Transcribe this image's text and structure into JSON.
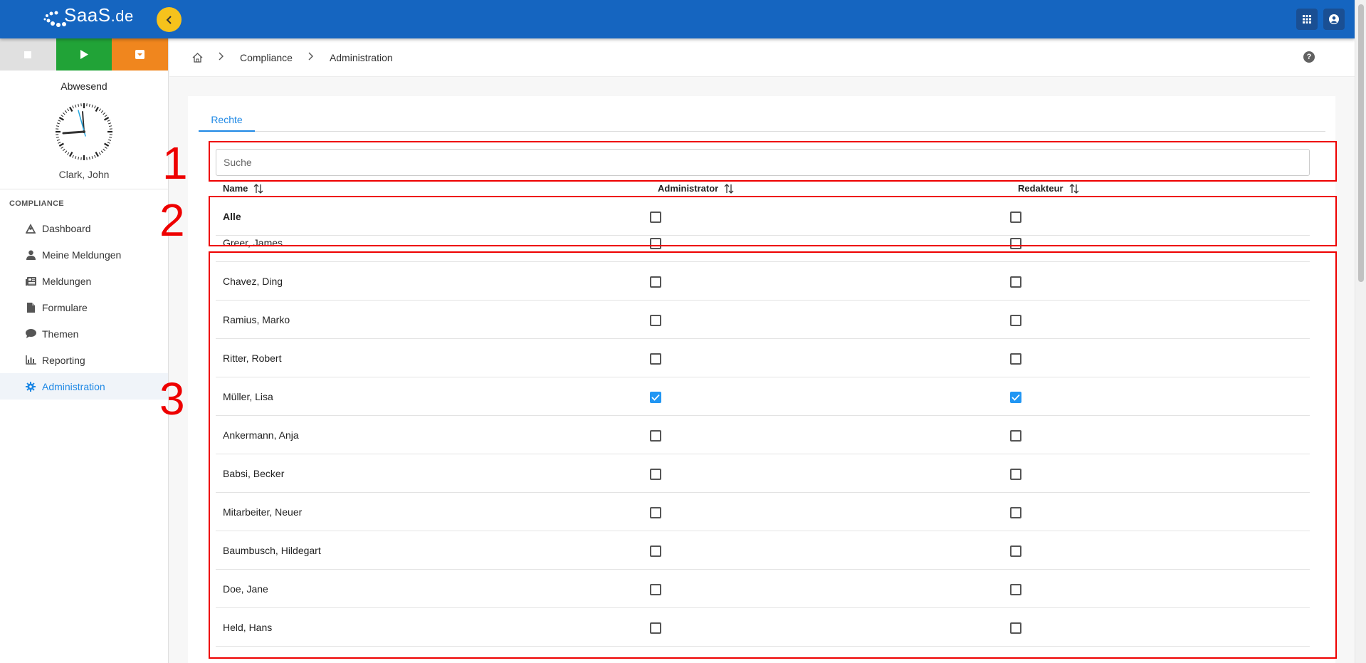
{
  "topbar": {
    "logo_text": "SaaS",
    "logo_suffix": ".de",
    "brand_color": "#1565c0",
    "collapse_icon": "chevron-left-icon",
    "apps_icon": "apps-grid-icon",
    "account_icon": "account-circle-icon"
  },
  "sidebar": {
    "status_buttons": [
      {
        "icon": "stop-icon",
        "color": "#e0e0e0"
      },
      {
        "icon": "play-icon",
        "color": "#21a337"
      },
      {
        "icon": "dropdown-icon",
        "color": "#f0861e"
      }
    ],
    "status_label": "Abwesend",
    "user_name": "Clark, John",
    "section_title": "COMPLIANCE",
    "items": [
      {
        "label": "Dashboard",
        "icon": "dashboard-icon"
      },
      {
        "label": "Meine Meldungen",
        "icon": "person-icon"
      },
      {
        "label": "Meldungen",
        "icon": "newspaper-icon"
      },
      {
        "label": "Formulare",
        "icon": "file-icon"
      },
      {
        "label": "Themen",
        "icon": "comment-icon"
      },
      {
        "label": "Reporting",
        "icon": "chart-icon"
      },
      {
        "label": "Administration",
        "icon": "gear-icon",
        "active": true
      }
    ]
  },
  "breadcrumb": {
    "home_icon": "home-icon",
    "items": [
      "Compliance",
      "Administration"
    ],
    "help_icon": "help-icon"
  },
  "tabs": [
    {
      "label": "Rechte",
      "active": true
    }
  ],
  "search": {
    "placeholder": "Suche",
    "value": ""
  },
  "table": {
    "columns": [
      {
        "label": "Name"
      },
      {
        "label": "Administrator"
      },
      {
        "label": "Redakteur"
      }
    ],
    "all_row": {
      "name": "Alle",
      "administrator": false,
      "redakteur": false
    },
    "rows": [
      {
        "name": "Greer, James",
        "administrator": false,
        "redakteur": false
      },
      {
        "name": "Chavez, Ding",
        "administrator": false,
        "redakteur": false
      },
      {
        "name": "Ramius, Marko",
        "administrator": false,
        "redakteur": false
      },
      {
        "name": "Ritter, Robert",
        "administrator": false,
        "redakteur": false
      },
      {
        "name": "Müller, Lisa",
        "administrator": true,
        "redakteur": true
      },
      {
        "name": "Ankermann, Anja",
        "administrator": false,
        "redakteur": false
      },
      {
        "name": "Babsi, Becker",
        "administrator": false,
        "redakteur": false
      },
      {
        "name": "Mitarbeiter, Neuer",
        "administrator": false,
        "redakteur": false
      },
      {
        "name": "Baumbusch, Hildegart",
        "administrator": false,
        "redakteur": false
      },
      {
        "name": "Doe, Jane",
        "administrator": false,
        "redakteur": false
      },
      {
        "name": "Held, Hans",
        "administrator": false,
        "redakteur": false
      }
    ]
  },
  "annotations": [
    "1",
    "2",
    "3"
  ],
  "accent_color": "#1e88e5",
  "annotation_color": "#ee0000"
}
